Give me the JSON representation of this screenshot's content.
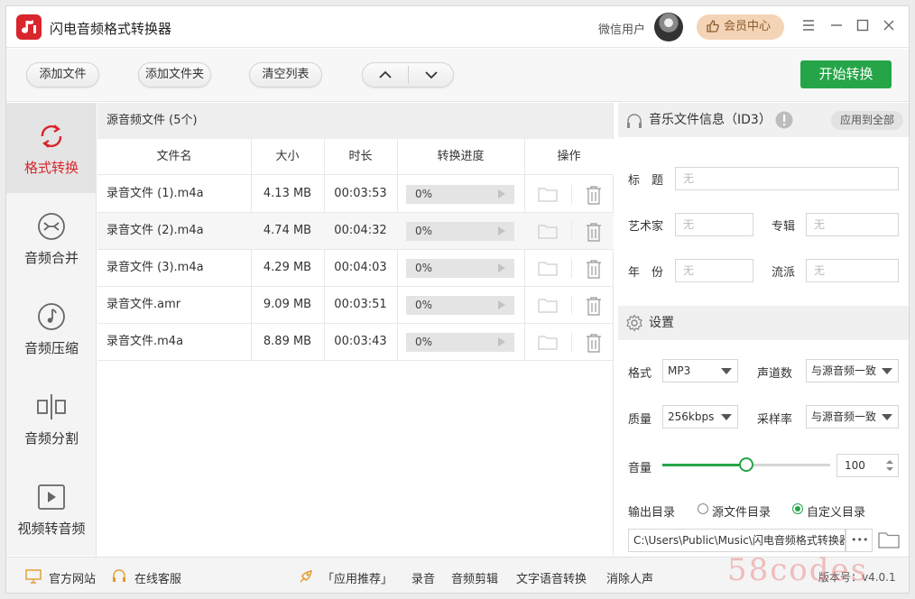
{
  "app": {
    "title": "闪电音频格式转换器",
    "user_name": "微信用户",
    "vip_label": "会员中心",
    "brand_color": "#d8262c",
    "accent_color": "#25a548"
  },
  "toolbar": {
    "add_file": "添加文件",
    "add_folder": "添加文件夹",
    "clear_list": "清空列表",
    "start": "开始转换"
  },
  "sidebar": {
    "items": [
      {
        "label": "格式转换",
        "icon": "refresh-icon",
        "active": true
      },
      {
        "label": "音频合并",
        "icon": "merge-icon",
        "active": false
      },
      {
        "label": "音频压缩",
        "icon": "music-note-icon",
        "active": false
      },
      {
        "label": "音频分割",
        "icon": "split-icon",
        "active": false
      },
      {
        "label": "视频转音频",
        "icon": "video-play-icon",
        "active": false
      }
    ]
  },
  "file_list": {
    "title": "源音频文件 (5个)",
    "columns": [
      "文件名",
      "大小",
      "时长",
      "转换进度",
      "操作"
    ],
    "rows": [
      {
        "name": "录音文件 (1).m4a",
        "size": "4.13 MB",
        "duration": "00:03:53",
        "progress": "0%"
      },
      {
        "name": "录音文件 (2).m4a",
        "size": "4.74 MB",
        "duration": "00:04:32",
        "progress": "0%"
      },
      {
        "name": "录音文件 (3).m4a",
        "size": "4.29 MB",
        "duration": "00:04:03",
        "progress": "0%"
      },
      {
        "name": "录音文件.amr",
        "size": "9.09 MB",
        "duration": "00:03:51",
        "progress": "0%"
      },
      {
        "name": "录音文件.m4a",
        "size": "8.89 MB",
        "duration": "00:03:43",
        "progress": "0%"
      }
    ]
  },
  "id3": {
    "title": "音乐文件信息（ID3）",
    "apply_all": "应用到全部",
    "title_label": "标　题",
    "title_value": "无",
    "artist_label": "艺术家",
    "artist_value": "无",
    "album_label": "专辑",
    "album_value": "无",
    "year_label": "年　份",
    "year_value": "无",
    "genre_label": "流派",
    "genre_value": "无"
  },
  "settings": {
    "title": "设置",
    "format_label": "格式",
    "format_value": "MP3",
    "channels_label": "声道数",
    "channels_value": "与源音频一致",
    "quality_label": "质量",
    "quality_value": "256kbps",
    "samplerate_label": "采样率",
    "samplerate_value": "与源音频一致",
    "volume_label": "音量",
    "volume_value": "100",
    "volume_level": 0.5,
    "output_label": "输出目录",
    "output_source": "源文件目录",
    "output_custom": "自定义目录",
    "output_selected": "custom",
    "output_path": "C:\\Users\\Public\\Music\\闪电音频格式转换器",
    "more_label": "•••"
  },
  "footer": {
    "website": "官方网站",
    "support": "在线客服",
    "recommend": "「应用推荐」",
    "links": [
      "录音",
      "音频剪辑",
      "文字语音转换",
      "消除人声"
    ],
    "version": "版本号：v4.0.1",
    "watermark": "58codes"
  }
}
